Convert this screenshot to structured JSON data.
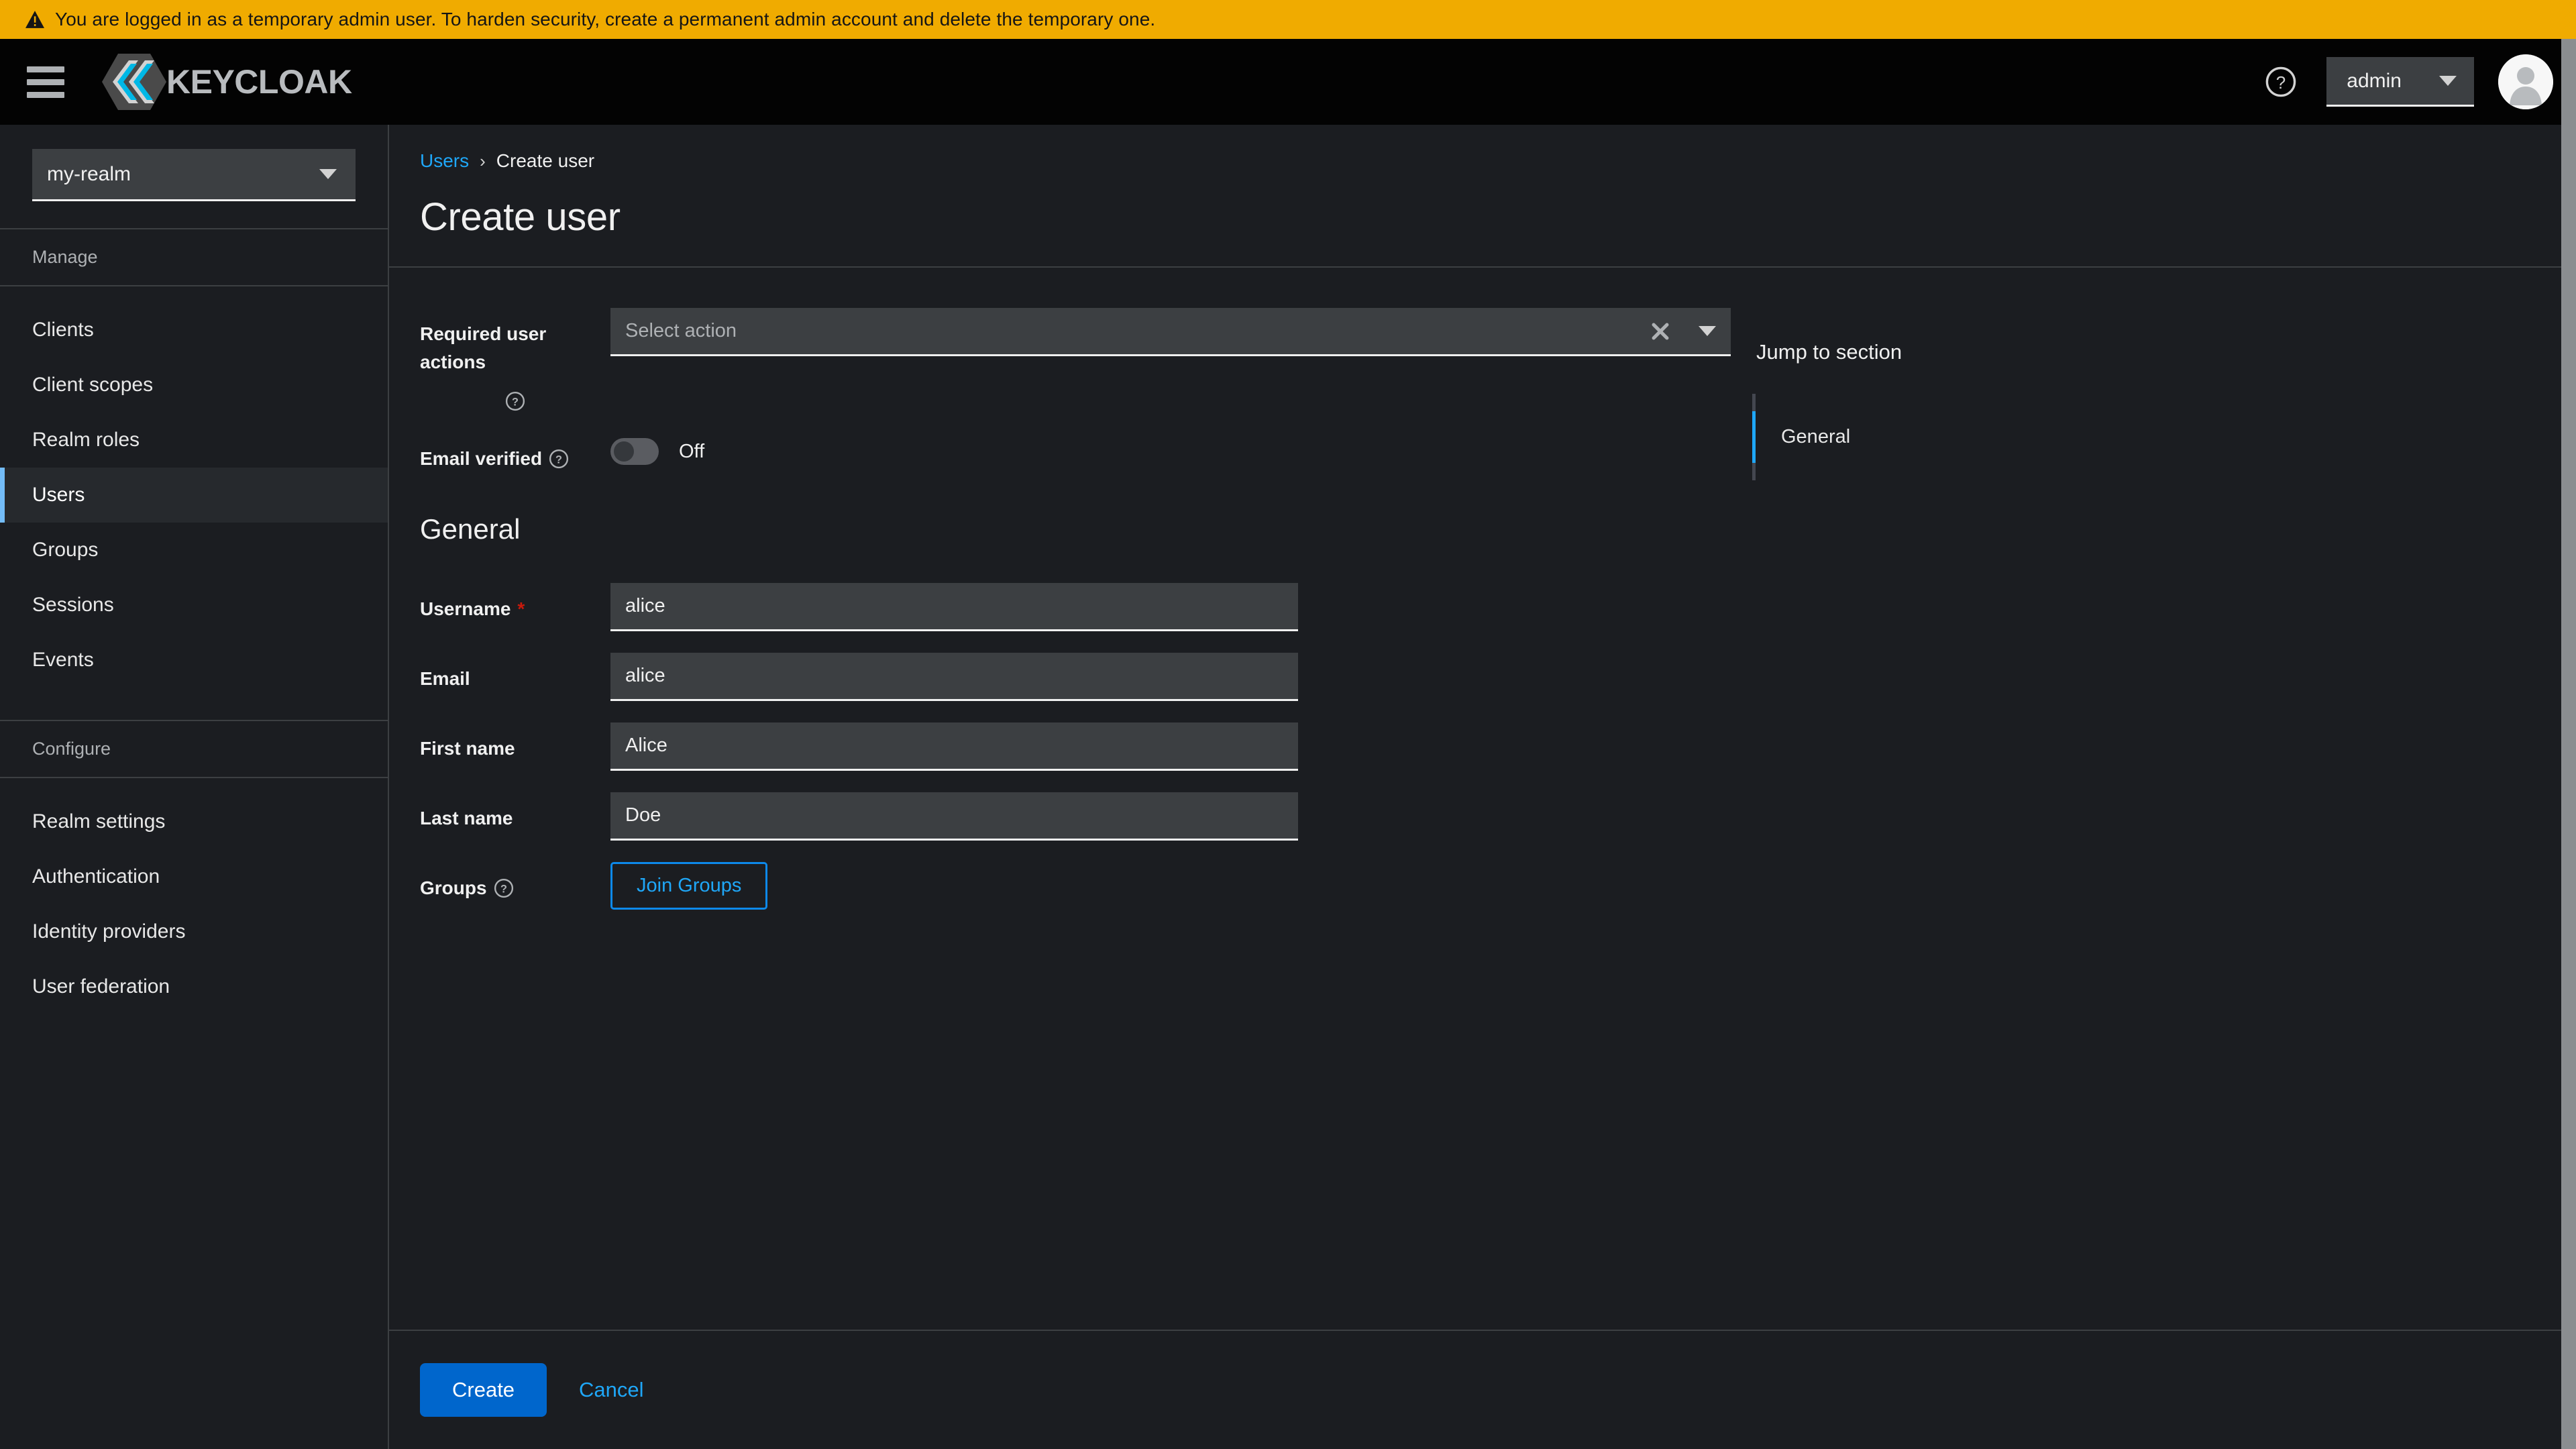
{
  "banner": {
    "icon": "warning-triangle-icon",
    "text": "You are logged in as a temporary admin user. To harden security, create a permanent admin account and delete the temporary one."
  },
  "masthead": {
    "menu_icon": "hamburger-menu-icon",
    "brand_name": "KEYCLOAK",
    "brand_logo_icon": "keycloak-logo-icon",
    "help_icon": "question-circle-icon",
    "user_menu_label": "admin",
    "user_menu_caret_icon": "caret-down-icon",
    "avatar_icon": "user-avatar-icon"
  },
  "sidebar": {
    "realm_selector": {
      "value": "my-realm",
      "caret_icon": "caret-down-icon"
    },
    "groups": [
      {
        "title": "Manage",
        "items": [
          {
            "label": "Clients",
            "active": false
          },
          {
            "label": "Client scopes",
            "active": false
          },
          {
            "label": "Realm roles",
            "active": false
          },
          {
            "label": "Users",
            "active": true
          },
          {
            "label": "Groups",
            "active": false
          },
          {
            "label": "Sessions",
            "active": false
          },
          {
            "label": "Events",
            "active": false
          }
        ]
      },
      {
        "title": "Configure",
        "items": [
          {
            "label": "Realm settings",
            "active": false
          },
          {
            "label": "Authentication",
            "active": false
          },
          {
            "label": "Identity providers",
            "active": false
          },
          {
            "label": "User federation",
            "active": false
          }
        ]
      }
    ]
  },
  "page": {
    "breadcrumb": {
      "parent": "Users",
      "separator": "›",
      "current": "Create user"
    },
    "title": "Create user"
  },
  "form": {
    "required_user_actions": {
      "label": "Required user actions",
      "help_icon": "question-circle-icon",
      "placeholder": "Select action",
      "value": "",
      "clear_icon": "times-icon",
      "toggle_icon": "caret-down-icon"
    },
    "email_verified": {
      "label": "Email verified",
      "help_icon": "question-circle-icon",
      "state_label": "Off",
      "checked": false
    },
    "general_section": {
      "title": "General",
      "fields": [
        {
          "label": "Username",
          "required": true,
          "value": "alice",
          "placeholder": ""
        },
        {
          "label": "Email",
          "required": false,
          "value": "alice",
          "placeholder": ""
        },
        {
          "label": "First name",
          "required": false,
          "value": "Alice",
          "placeholder": ""
        },
        {
          "label": "Last name",
          "required": false,
          "value": "Doe",
          "placeholder": ""
        }
      ],
      "groups_row": {
        "label": "Groups",
        "help_icon": "question-circle-icon",
        "button_label": "Join Groups"
      }
    }
  },
  "jump_to_section": {
    "title": "Jump to section",
    "items": [
      {
        "label": "General",
        "active": true
      }
    ]
  },
  "footer": {
    "submit_label": "Create",
    "cancel_label": "Cancel"
  },
  "colors": {
    "banner_bg": "#f0ab00",
    "masthead_bg": "#030303",
    "page_bg": "#1b1d21",
    "accent_blue": "#0066cc",
    "link_blue": "#1fa7f8",
    "active_nav_blue": "#73bcf7",
    "required_red": "#c9190b",
    "input_bg": "#3c3f42"
  }
}
